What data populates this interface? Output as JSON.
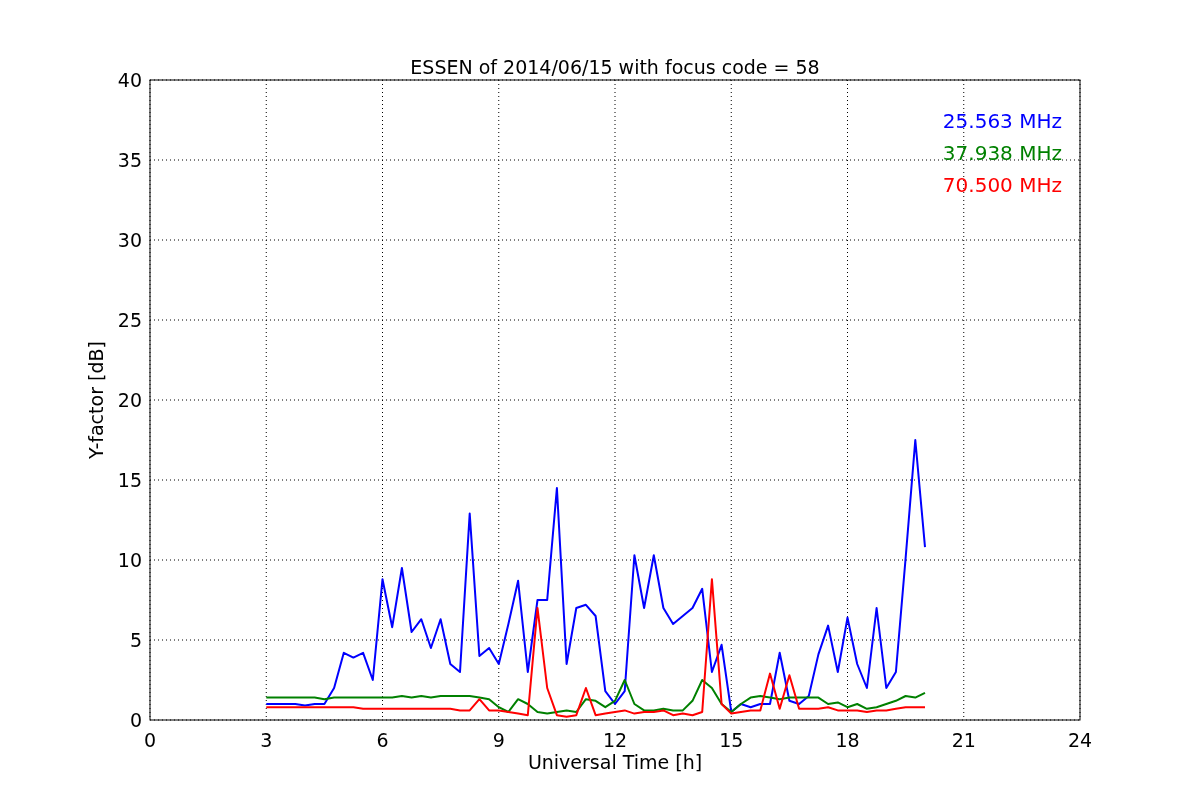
{
  "chart_data": {
    "type": "line",
    "title": "ESSEN of 2014/06/15 with focus code = 58",
    "xlabel": "Universal Time [h]",
    "ylabel": "Y-factor [dB]",
    "x": [
      3,
      3.25,
      3.5,
      3.75,
      4,
      4.25,
      4.5,
      4.75,
      5,
      5.25,
      5.5,
      5.75,
      6,
      6.25,
      6.5,
      6.75,
      7,
      7.25,
      7.5,
      7.75,
      8,
      8.25,
      8.5,
      8.75,
      9,
      9.25,
      9.5,
      9.75,
      10,
      10.25,
      10.5,
      10.75,
      11,
      11.25,
      11.5,
      11.75,
      12,
      12.25,
      12.5,
      12.75,
      13,
      13.25,
      13.5,
      13.75,
      14,
      14.25,
      14.5,
      14.75,
      15,
      15.25,
      15.5,
      15.75,
      16,
      16.25,
      16.5,
      16.75,
      17,
      17.25,
      17.5,
      17.75,
      18,
      18.25,
      18.5,
      18.75,
      19,
      19.25,
      19.5,
      19.75,
      20
    ],
    "series": [
      {
        "name": "25.563 MHz",
        "color": "#0000ff",
        "values": [
          1,
          1,
          1,
          1,
          0.9,
          1,
          1,
          2,
          4.2,
          3.9,
          4.2,
          2.5,
          8.8,
          5.8,
          9.5,
          5.5,
          6.3,
          4.5,
          6.3,
          3.5,
          3,
          12.9,
          4,
          4.5,
          3.5,
          6,
          8.7,
          3,
          7.5,
          7.5,
          14.5,
          3.5,
          7,
          7.2,
          6.5,
          1.8,
          1,
          1.8,
          10.3,
          7,
          10.3,
          7,
          6,
          6.5,
          7,
          8.2,
          3,
          4.7,
          0.5,
          1,
          0.8,
          1,
          1,
          4.2,
          1.2,
          1,
          1.5,
          4.1,
          5.9,
          3,
          6.4,
          3.5,
          2,
          7,
          2,
          3,
          10.1,
          17.5,
          10.8
        ]
      },
      {
        "name": "37.938 MHz",
        "color": "#008000",
        "values": [
          1.4,
          1.4,
          1.4,
          1.4,
          1.4,
          1.4,
          1.3,
          1.4,
          1.4,
          1.4,
          1.4,
          1.4,
          1.4,
          1.4,
          1.5,
          1.4,
          1.5,
          1.4,
          1.5,
          1.5,
          1.5,
          1.5,
          1.4,
          1.3,
          0.8,
          0.5,
          1.3,
          1.0,
          0.5,
          0.4,
          0.5,
          0.6,
          0.5,
          1.3,
          1.2,
          0.8,
          1.2,
          2.5,
          1.0,
          0.6,
          0.6,
          0.7,
          0.6,
          0.6,
          1.2,
          2.5,
          2.0,
          1.0,
          0.5,
          1.0,
          1.4,
          1.5,
          1.4,
          1.3,
          1.4,
          1.4,
          1.4,
          1.4,
          1.0,
          1.1,
          0.8,
          1.0,
          0.7,
          0.8,
          1.0,
          1.2,
          1.5,
          1.4,
          1.7
        ]
      },
      {
        "name": "70.500 MHz",
        "color": "#ff0000",
        "values": [
          0.8,
          0.8,
          0.8,
          0.8,
          0.8,
          0.8,
          0.8,
          0.8,
          0.8,
          0.8,
          0.7,
          0.7,
          0.7,
          0.7,
          0.7,
          0.7,
          0.7,
          0.7,
          0.7,
          0.7,
          0.6,
          0.6,
          1.3,
          0.6,
          0.6,
          0.5,
          0.4,
          0.3,
          7.0,
          2.0,
          0.3,
          0.2,
          0.3,
          2.0,
          0.3,
          0.4,
          0.5,
          0.6,
          0.4,
          0.5,
          0.5,
          0.6,
          0.3,
          0.4,
          0.3,
          0.5,
          8.8,
          1.0,
          0.4,
          0.5,
          0.6,
          0.6,
          2.9,
          0.7,
          2.8,
          0.7,
          0.7,
          0.7,
          0.8,
          0.6,
          0.6,
          0.6,
          0.5,
          0.6,
          0.6,
          0.7,
          0.8,
          0.8,
          0.8
        ]
      }
    ],
    "xlim": [
      0,
      24
    ],
    "ylim": [
      0,
      40
    ],
    "grid": true,
    "xticks": [
      0,
      3,
      6,
      9,
      12,
      15,
      18,
      21,
      24
    ],
    "yticks": [
      0,
      5,
      10,
      15,
      20,
      25,
      30,
      35,
      40
    ]
  }
}
